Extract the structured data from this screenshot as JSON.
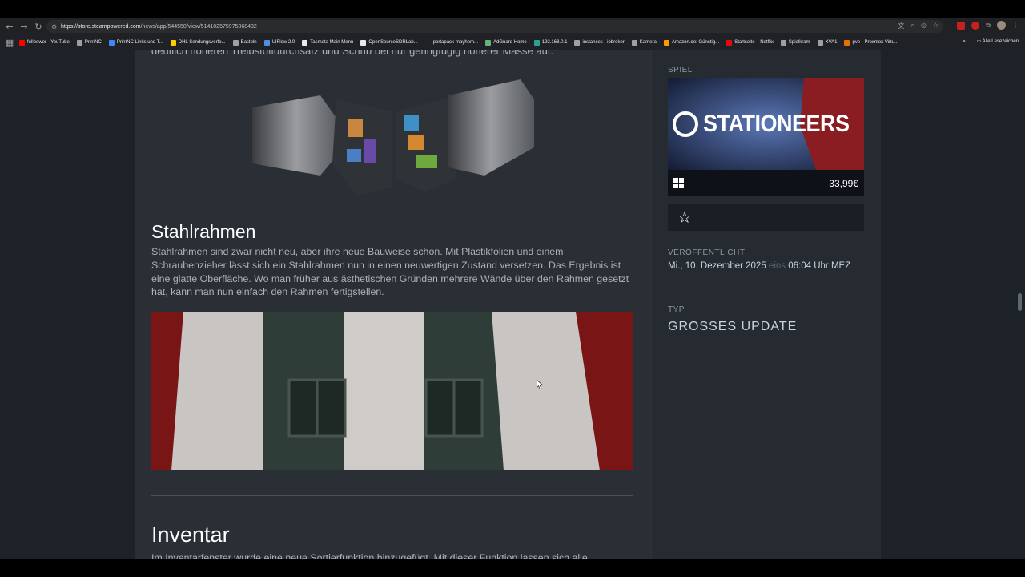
{
  "browser": {
    "url_domain": "https://store.steampowered.com",
    "url_path": "/news/app/544550/view/514102575975368432",
    "bookmarks": [
      {
        "label": "fellpower - YouTube",
        "color": "#ff0000"
      },
      {
        "label": "PrintNC",
        "color": "#9aa0a6"
      },
      {
        "label": "PrintNC Links und T...",
        "color": "#4285f4"
      },
      {
        "label": "DHL Sendungsverfo...",
        "color": "#ffcc00"
      },
      {
        "label": "Basteln",
        "color": "#9aa0a6"
      },
      {
        "label": "UIFlow 2.0",
        "color": "#4a90e2"
      },
      {
        "label": "Tasmota Main Menu",
        "color": "#e8eaed"
      },
      {
        "label": "OpenSourceSDRLab...",
        "color": "#e8eaed"
      },
      {
        "label": "portapack-mayhem...",
        "color": "#202124"
      },
      {
        "label": "AdGuard Home",
        "color": "#67b279"
      },
      {
        "label": "192.168.0.1",
        "color": "#2aa198"
      },
      {
        "label": "instances - iobroker",
        "color": "#9aa0a6"
      },
      {
        "label": "Kamera",
        "color": "#9aa0a6"
      },
      {
        "label": "Amazon.de: Günstig...",
        "color": "#ff9900"
      },
      {
        "label": "Startseite – Netflix",
        "color": "#e50914"
      },
      {
        "label": "Spielkram",
        "color": "#9aa0a6"
      },
      {
        "label": "XVA1",
        "color": "#9aa0a6"
      },
      {
        "label": "pve - Proxmox Virtu...",
        "color": "#e57000"
      }
    ],
    "all_bookmarks": "Alle Lesezeichen",
    "more_bookmarks": "»"
  },
  "article": {
    "cut_text": "deutlich höheren Treibstoffdurchsatz und Schub bei nur geringfügig höherer Masse auf.",
    "section1_title": "Stahlrahmen",
    "section1_body": "Stahlrahmen sind zwar nicht neu, aber ihre neue Bauweise schon. Mit Plastikfolien und einem Schraubenzieher lässt sich ein Stahlrahmen nun in einen neuwertigen Zustand versetzen. Das Ergebnis ist eine glatte Oberfläche. Wo man früher aus ästhetischen Gründen mehrere Wände über den Rahmen gesetzt hat, kann man nun einfach den Rahmen fertigstellen.",
    "section2_title": "Inventar",
    "section2_body": "Im Inventarfenster wurde eine neue Sortierfunktion hinzugefügt. Mit dieser Funktion lassen sich alle"
  },
  "sidebar": {
    "game_label": "SPIEL",
    "game_title": "STATIONEERS",
    "price": "33,99€",
    "released_label": "VERÖFFENTLICHT",
    "date_prefix": "Mi., 10. Dezember 2025",
    "date_eins": "eins",
    "date_time": "06:04",
    "date_tz": "Uhr MEZ",
    "type_label": "TYP",
    "type_value": "GROSSES UPDATE"
  },
  "colors": {
    "steam_bg": "#1d2229",
    "article_bg": "#2a2e35",
    "text_muted": "#acb2b8"
  }
}
